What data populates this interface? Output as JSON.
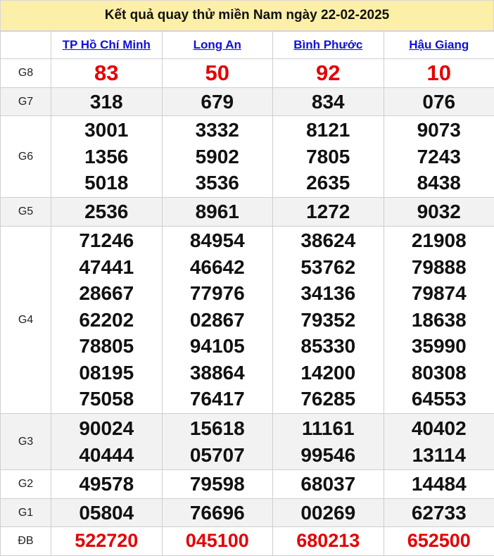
{
  "title": "Kết quả quay thử miền Nam ngày 22-02-2025",
  "provinces": [
    "TP Hồ Chí Minh",
    "Long An",
    "Bình Phước",
    "Hậu Giang"
  ],
  "colors": {
    "title_bg": "#fcefa7",
    "link": "#1010d8",
    "highlight": "#e40000",
    "alt_row": "#f2f2f2"
  },
  "prizes": [
    {
      "label": "G8",
      "values": [
        [
          "83"
        ],
        [
          "50"
        ],
        [
          "92"
        ],
        [
          "10"
        ]
      ]
    },
    {
      "label": "G7",
      "values": [
        [
          "318"
        ],
        [
          "679"
        ],
        [
          "834"
        ],
        [
          "076"
        ]
      ]
    },
    {
      "label": "G6",
      "values": [
        [
          "3001",
          "1356",
          "5018"
        ],
        [
          "3332",
          "5902",
          "3536"
        ],
        [
          "8121",
          "7805",
          "2635"
        ],
        [
          "9073",
          "7243",
          "8438"
        ]
      ]
    },
    {
      "label": "G5",
      "values": [
        [
          "2536"
        ],
        [
          "8961"
        ],
        [
          "1272"
        ],
        [
          "9032"
        ]
      ]
    },
    {
      "label": "G4",
      "values": [
        [
          "71246",
          "47441",
          "28667",
          "62202",
          "78805",
          "08195",
          "75058"
        ],
        [
          "84954",
          "46642",
          "77976",
          "02867",
          "94105",
          "38864",
          "76417"
        ],
        [
          "38624",
          "53762",
          "34136",
          "79352",
          "85330",
          "14200",
          "76285"
        ],
        [
          "21908",
          "79888",
          "79874",
          "18638",
          "35990",
          "80308",
          "64553"
        ]
      ]
    },
    {
      "label": "G3",
      "values": [
        [
          "90024",
          "40444"
        ],
        [
          "15618",
          "05707"
        ],
        [
          "11161",
          "99546"
        ],
        [
          "40402",
          "13114"
        ]
      ]
    },
    {
      "label": "G2",
      "values": [
        [
          "49578"
        ],
        [
          "79598"
        ],
        [
          "68037"
        ],
        [
          "14484"
        ]
      ]
    },
    {
      "label": "G1",
      "values": [
        [
          "05804"
        ],
        [
          "76696"
        ],
        [
          "00269"
        ],
        [
          "62733"
        ]
      ]
    },
    {
      "label": "ĐB",
      "values": [
        [
          "522720"
        ],
        [
          "045100"
        ],
        [
          "680213"
        ],
        [
          "652500"
        ]
      ]
    }
  ]
}
